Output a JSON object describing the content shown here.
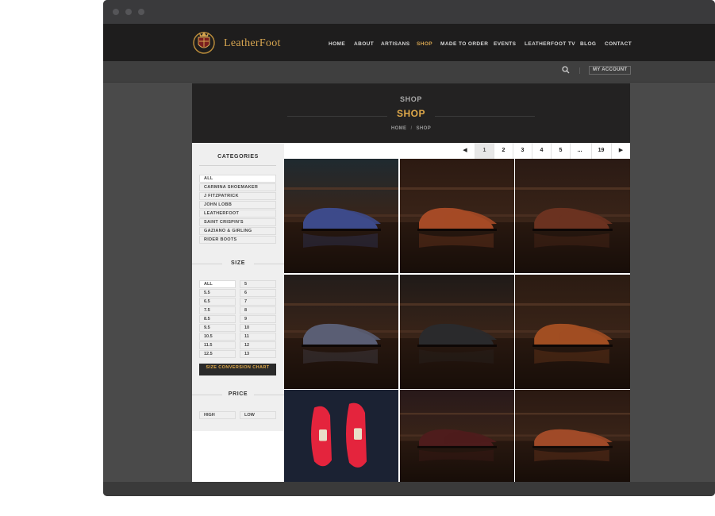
{
  "brand": {
    "name": "LeatherFoot"
  },
  "nav": [
    "HOME",
    "ABOUT",
    "ARTISANS",
    "SHOP",
    "MADE TO ORDER",
    "EVENTS",
    "LEATHERFOOT TV",
    "BLOG",
    "CONTACT"
  ],
  "nav_active": "SHOP",
  "account": {
    "label": "MY ACCOUNT"
  },
  "hero": {
    "sup": "SHOP",
    "title": "SHOP",
    "crumb_home": "HOME",
    "crumb_sep": "/",
    "crumb_current": "SHOP"
  },
  "sidebar": {
    "categories_title": "CATEGORIES",
    "categories": [
      "ALL",
      "CARMINA SHOEMAKER",
      "J FITZPATRICK",
      "JOHN LOBB",
      "LEATHERFOOT",
      "SAINT CRISPIN'S",
      "GAZIANO & GIRLING",
      "RIDER BOOTS"
    ],
    "size_title": "SIZE",
    "sizes_left": [
      "ALL",
      "5.5",
      "6.5",
      "7.5",
      "8.5",
      "9.5",
      "10.5",
      "11.5",
      "12.5"
    ],
    "sizes_right": [
      "5",
      "6",
      "7",
      "8",
      "9",
      "10",
      "11",
      "12",
      "13"
    ],
    "conversion_label": "SIZE CONVERSION CHART",
    "price_title": "PRICE",
    "price_options": [
      "HIGH",
      "LOW"
    ]
  },
  "pager": {
    "prev": "◀",
    "pages": [
      "1",
      "2",
      "3",
      "4",
      "5",
      "...",
      "19"
    ],
    "current": "1",
    "next": "▶"
  },
  "colors": {
    "accent": "#e1aa4a",
    "nav_bg": "#1e1d1d",
    "hero_bg": "#232222"
  },
  "products": [
    {
      "name": "blue-suede-boot",
      "shoe": "#3d4a8a",
      "bg": "#1f2a30"
    },
    {
      "name": "tan-chukka",
      "shoe": "#a54a26",
      "bg": "#2c1a12"
    },
    {
      "name": "brown-wingtip",
      "shoe": "#6b3220",
      "bg": "#2a1a14"
    },
    {
      "name": "grey-suede-oxford",
      "shoe": "#5a5e74",
      "bg": "#231d1b"
    },
    {
      "name": "black-oxford",
      "shoe": "#2a2a2c",
      "bg": "#1f1a18"
    },
    {
      "name": "tan-derby",
      "shoe": "#a14e22",
      "bg": "#2b1b12"
    },
    {
      "name": "red-loafer",
      "shoe": "#e4243d",
      "bg": "#1b2233"
    },
    {
      "name": "burgundy-boot",
      "shoe": "#4e1c1c",
      "bg": "#28191a"
    },
    {
      "name": "tan-wingtip",
      "shoe": "#a04a28",
      "bg": "#2a1912"
    }
  ]
}
